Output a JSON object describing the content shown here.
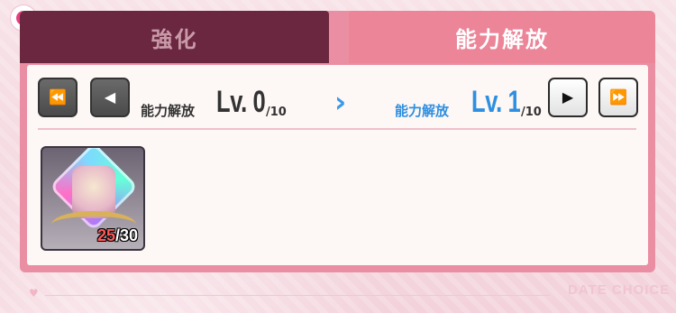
{
  "tabs": {
    "inactive_label": "強化",
    "active_label": "能力解放"
  },
  "levels": {
    "current": {
      "label": "能力解放",
      "prefix": "Lv.",
      "value": "0",
      "max": "/10"
    },
    "next": {
      "label": "能力解放",
      "prefix": "Lv.",
      "value": "1",
      "max": "/10"
    }
  },
  "buttons": {
    "first_glyph": "⏪",
    "prev_glyph": "◀",
    "next_glyph": "▶",
    "last_glyph": "⏩"
  },
  "arrow_glyph": "›",
  "item": {
    "count_current": "25",
    "count_total": "/30"
  },
  "footer": {
    "brand": "DATE CHOICE"
  }
}
